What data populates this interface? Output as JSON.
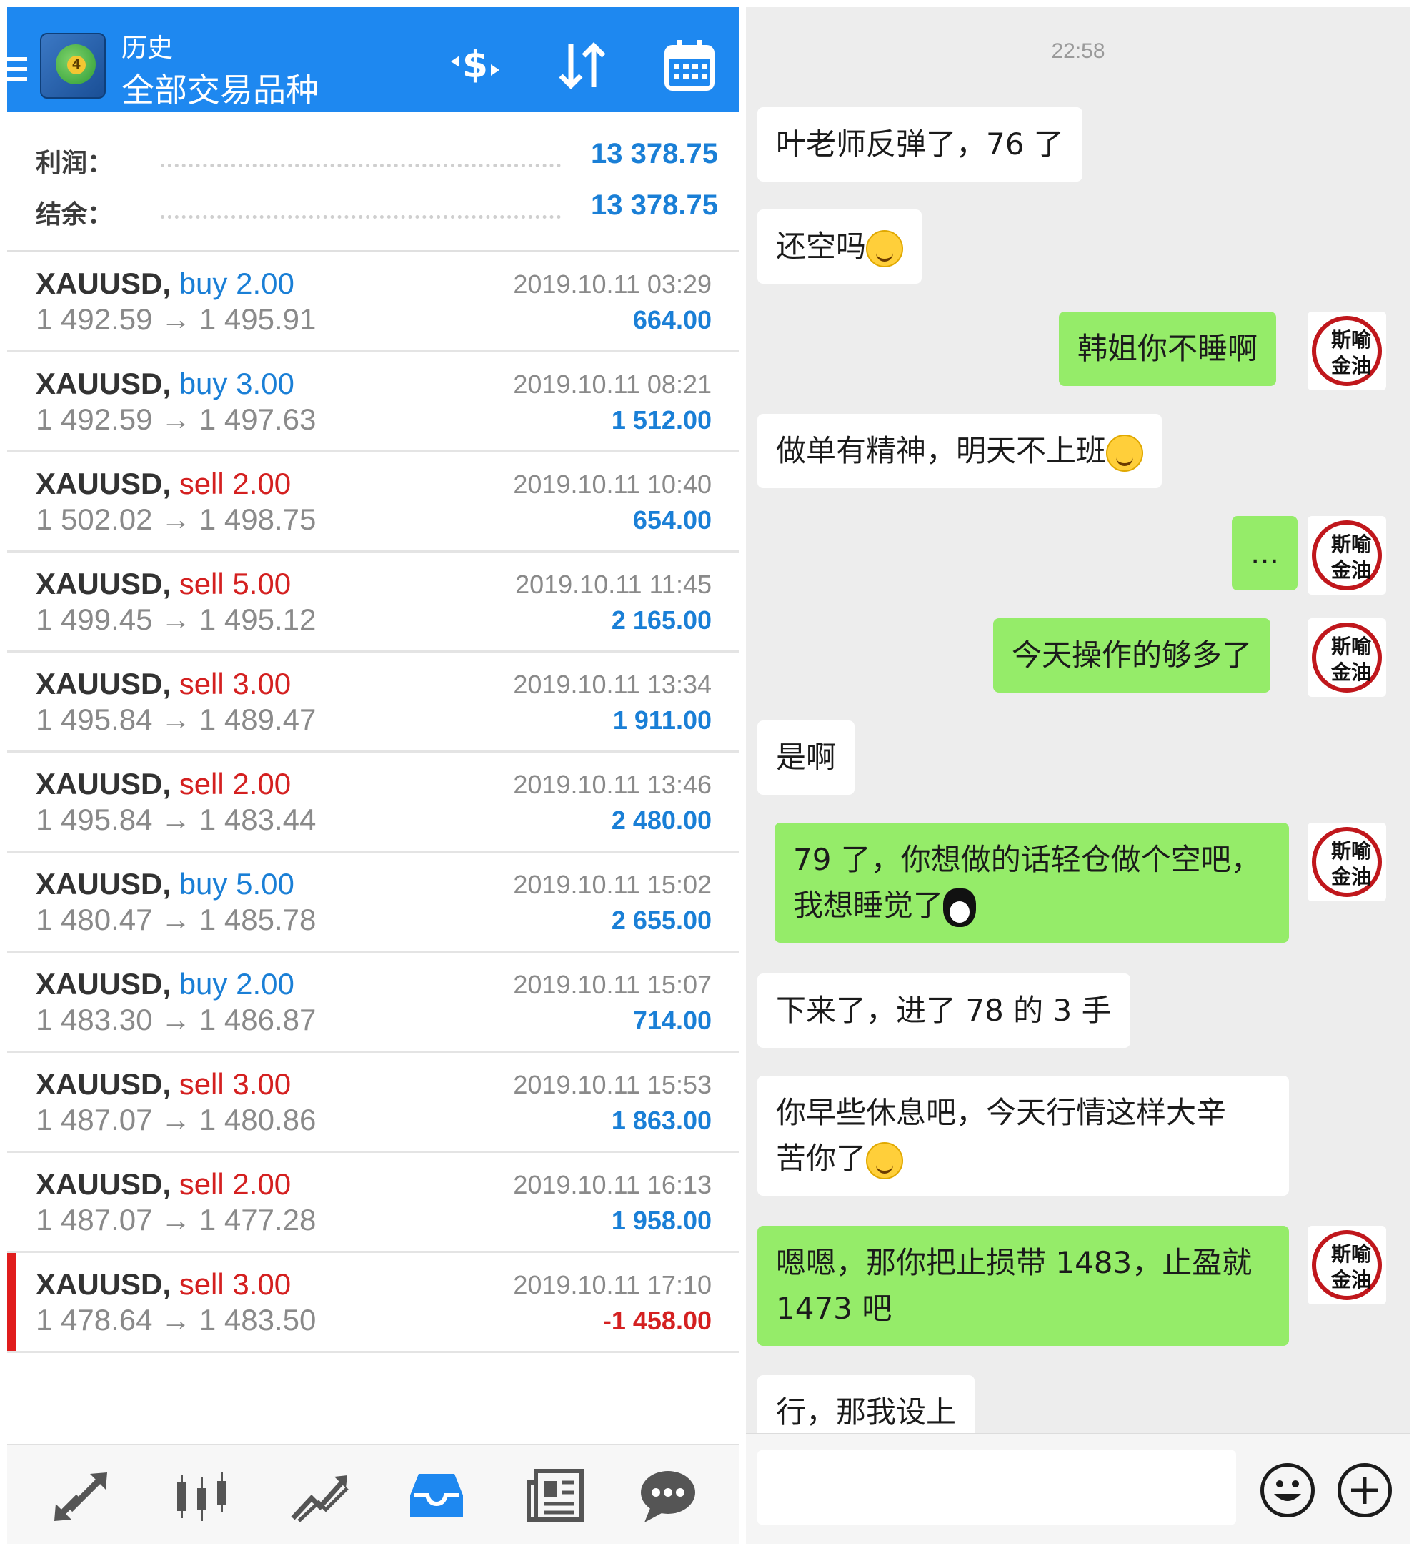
{
  "mt4": {
    "header": {
      "title_small": "历史",
      "title_big": "全部交易品种"
    },
    "summary": {
      "profit_label": "利润：",
      "profit_value": "13 378.75",
      "balance_label": "结余：",
      "balance_value": "13 378.75"
    },
    "trades": [
      {
        "symbol": "XAUUSD,",
        "type": "buy",
        "volume": "2.00",
        "open": "1 492.59",
        "close": "1 495.91",
        "time": "2019.10.11 03:29",
        "profit": "664.00"
      },
      {
        "symbol": "XAUUSD,",
        "type": "buy",
        "volume": "3.00",
        "open": "1 492.59",
        "close": "1 497.63",
        "time": "2019.10.11 08:21",
        "profit": "1 512.00"
      },
      {
        "symbol": "XAUUSD,",
        "type": "sell",
        "volume": "2.00",
        "open": "1 502.02",
        "close": "1 498.75",
        "time": "2019.10.11 10:40",
        "profit": "654.00"
      },
      {
        "symbol": "XAUUSD,",
        "type": "sell",
        "volume": "5.00",
        "open": "1 499.45",
        "close": "1 495.12",
        "time": "2019.10.11 11:45",
        "profit": "2 165.00"
      },
      {
        "symbol": "XAUUSD,",
        "type": "sell",
        "volume": "3.00",
        "open": "1 495.84",
        "close": "1 489.47",
        "time": "2019.10.11 13:34",
        "profit": "1 911.00"
      },
      {
        "symbol": "XAUUSD,",
        "type": "sell",
        "volume": "2.00",
        "open": "1 495.84",
        "close": "1 483.44",
        "time": "2019.10.11 13:46",
        "profit": "2 480.00"
      },
      {
        "symbol": "XAUUSD,",
        "type": "buy",
        "volume": "5.00",
        "open": "1 480.47",
        "close": "1 485.78",
        "time": "2019.10.11 15:02",
        "profit": "2 655.00"
      },
      {
        "symbol": "XAUUSD,",
        "type": "buy",
        "volume": "2.00",
        "open": "1 483.30",
        "close": "1 486.87",
        "time": "2019.10.11 15:07",
        "profit": "714.00"
      },
      {
        "symbol": "XAUUSD,",
        "type": "sell",
        "volume": "3.00",
        "open": "1 487.07",
        "close": "1 480.86",
        "time": "2019.10.11 15:53",
        "profit": "1 863.00"
      },
      {
        "symbol": "XAUUSD,",
        "type": "sell",
        "volume": "2.00",
        "open": "1 487.07",
        "close": "1 477.28",
        "time": "2019.10.11 16:13",
        "profit": "1 958.00"
      },
      {
        "symbol": "XAUUSD,",
        "type": "sell",
        "volume": "3.00",
        "open": "1 478.64",
        "close": "1 483.50",
        "time": "2019.10.11 17:10",
        "profit": "-1 458.00"
      }
    ],
    "arrow_glyph": "→",
    "nav_icons": [
      "trade-icon",
      "quotes-icon",
      "chart-icon",
      "history-icon",
      "news-icon",
      "chat-icon"
    ],
    "colors": {
      "header": "#1e88f0",
      "buy": "#1a7fd6",
      "sell": "#d42020"
    }
  },
  "chat": {
    "timestamp": "22:58",
    "avatar_text": "斯喻金油",
    "messages": [
      {
        "side": "in",
        "text": "叶老师反弹了，76 了"
      },
      {
        "side": "in",
        "text": "还空吗",
        "emoji": "grin-emoji"
      },
      {
        "side": "out",
        "text": "韩姐你不睡啊"
      },
      {
        "side": "in",
        "text": "做单有精神，明天不上班",
        "emoji": "heart-eyes-emoji"
      },
      {
        "side": "out",
        "text": "..."
      },
      {
        "side": "out",
        "text": "今天操作的够多了"
      },
      {
        "side": "in",
        "text": "是啊"
      },
      {
        "side": "out",
        "text_line1": "79 了，你想做的话轻仓做个空吧，",
        "text_line2": "我想睡觉了",
        "emoji": "penguin-emoji"
      },
      {
        "side": "in",
        "text": "下来了，进了 78 的 3 手"
      },
      {
        "side": "in",
        "text_line1": "你早些休息吧，今天行情这样大辛",
        "text_line2": "苦你了",
        "emoji": "kiss-emoji"
      },
      {
        "side": "out",
        "text_line1": "嗯嗯，那你把止损带 1483，止盈就",
        "text_line2": "1473 吧"
      },
      {
        "side": "in",
        "text": "行，那我设上"
      }
    ]
  }
}
